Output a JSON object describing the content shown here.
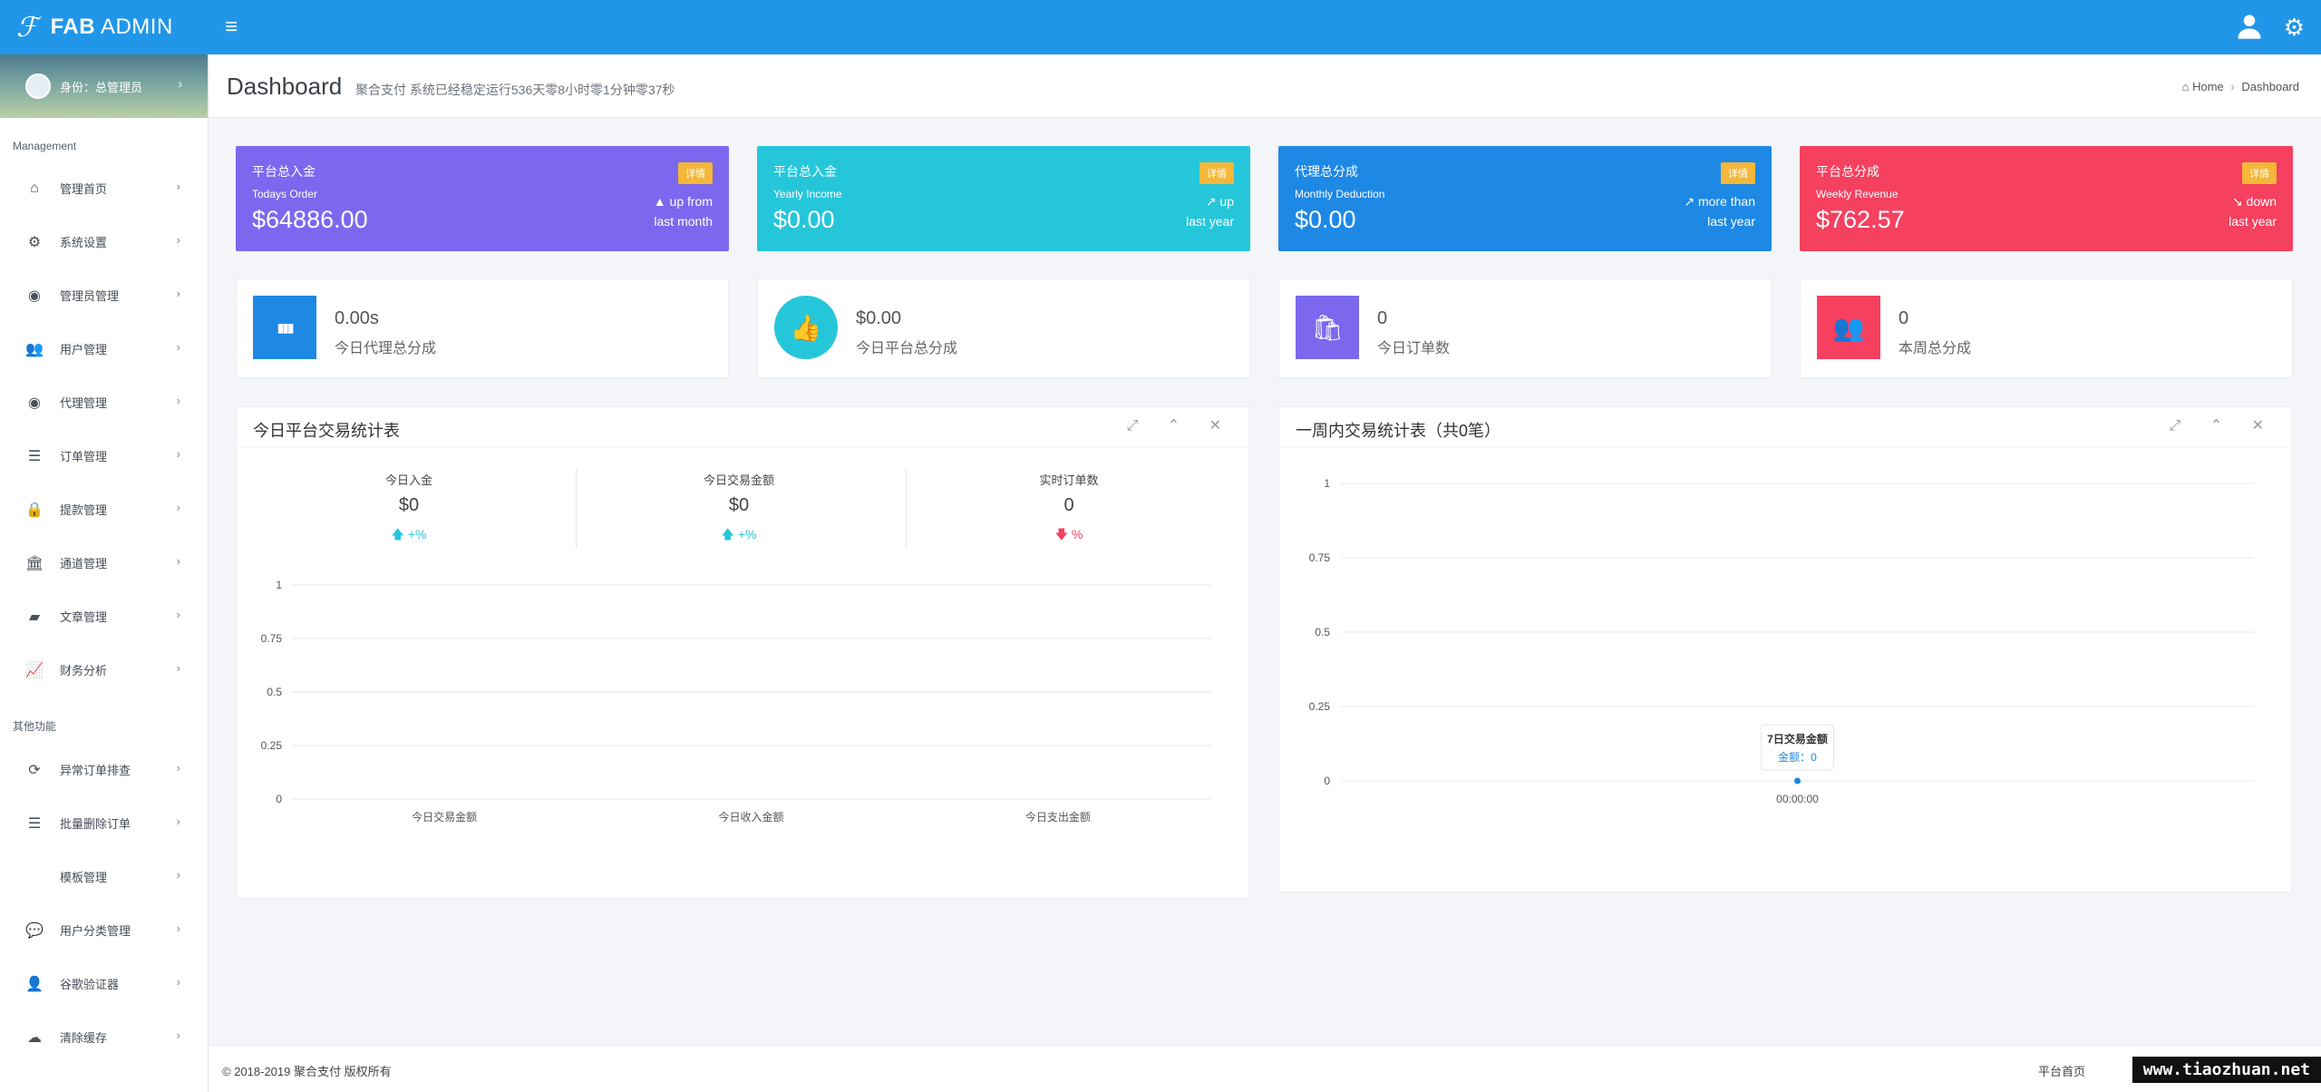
{
  "app": {
    "logo_mark": "ℱ",
    "logo_bold": "FAB",
    "logo_rest": " ADMIN",
    "menu_icon": "≡"
  },
  "profile": {
    "label": "身份：总管理员",
    "chevron": "›"
  },
  "sidebar": {
    "group1_title": "Management",
    "group1": [
      {
        "label": "管理首页",
        "icon": "home-icon",
        "glyph": "⌂"
      },
      {
        "label": "系统设置",
        "icon": "gears-icon",
        "glyph": "⚙"
      },
      {
        "label": "管理员管理",
        "icon": "user-circle-icon",
        "glyph": "◉"
      },
      {
        "label": "用户管理",
        "icon": "users-icon",
        "glyph": "👥"
      },
      {
        "label": "代理管理",
        "icon": "user-circle-icon",
        "glyph": "◉"
      },
      {
        "label": "订单管理",
        "icon": "list-icon",
        "glyph": "☰"
      },
      {
        "label": "提款管理",
        "icon": "lock-icon",
        "glyph": "🔒"
      },
      {
        "label": "通道管理",
        "icon": "bank-icon",
        "glyph": "🏛"
      },
      {
        "label": "文章管理",
        "icon": "book-icon",
        "glyph": "▰"
      },
      {
        "label": "财务分析",
        "icon": "line-chart-icon",
        "glyph": "📈"
      }
    ],
    "group2_title": "其他功能",
    "group2": [
      {
        "label": "异常订单排查",
        "icon": "refresh-icon",
        "glyph": "⟳"
      },
      {
        "label": "批量删除订单",
        "icon": "list-icon",
        "glyph": "☰"
      },
      {
        "label": "模板管理",
        "icon": "apple-icon",
        "glyph": ""
      },
      {
        "label": "用户分类管理",
        "icon": "wechat-icon",
        "glyph": "💬"
      },
      {
        "label": "谷歌验证器",
        "icon": "user-icon",
        "glyph": "👤"
      },
      {
        "label": "清除缓存",
        "icon": "cloud-icon",
        "glyph": "☁"
      }
    ],
    "chevron": "›"
  },
  "header": {
    "title": "Dashboard",
    "subtitle": "聚合支付 系统已经稳定运行536天零8小时零1分钟零37秒",
    "breadcrumb_home": "Home",
    "breadcrumb_sep": "›",
    "breadcrumb_current": "Dashboard"
  },
  "stat_cards": [
    {
      "title": "平台总入金",
      "sub": "Todays Order",
      "value": "$64886.00",
      "badge": "详情",
      "trend_l1": "up from",
      "trend_l2": "last month",
      "color": "#7b68ee",
      "arrow": "▲"
    },
    {
      "title": "平台总入金",
      "sub": "Yearly Income",
      "value": "$0.00",
      "badge": "详情",
      "trend_l1": "up",
      "trend_l2": "last year",
      "color": "#26c6da",
      "arrow": "↗"
    },
    {
      "title": "代理总分成",
      "sub": "Monthly Deduction",
      "value": "$0.00",
      "badge": "详情",
      "trend_l1": "more than",
      "trend_l2": "last year",
      "color": "#1e88e5",
      "arrow": "↗"
    },
    {
      "title": "平台总分成",
      "sub": "Weekly Revenue",
      "value": "$762.57",
      "badge": "详情",
      "trend_l1": "down",
      "trend_l2": "last year",
      "color": "#f5405f",
      "arrow": "↘"
    }
  ],
  "mini_cards": [
    {
      "value": "0.00s",
      "label": "今日代理总分成",
      "color": "#1e88e5",
      "icon": "bar-chart-icon",
      "glyph": "▮▮▮",
      "round": false
    },
    {
      "value": "$0.00",
      "label": "今日平台总分成",
      "color": "#26c6da",
      "icon": "thumbs-up-icon",
      "glyph": "👍",
      "round": true
    },
    {
      "value": "0",
      "label": "今日订单数",
      "color": "#7b68ee",
      "icon": "shopping-bag-icon",
      "glyph": "🛍",
      "round": false
    },
    {
      "value": "0",
      "label": "本周总分成",
      "color": "#f5405f",
      "icon": "users-icon",
      "glyph": "👥",
      "round": false
    }
  ],
  "panel_left": {
    "title": "今日平台交易统计表",
    "tools": "⤢ ⌃ ✕",
    "summary": [
      {
        "label": "今日入金",
        "value": "$0",
        "arrow": "🡅",
        "trend": "+%",
        "color": "#26c6da"
      },
      {
        "label": "今日交易金额",
        "value": "$0",
        "arrow": "🡅",
        "trend": "+%",
        "color": "#26c6da"
      },
      {
        "label": "实时订单数",
        "value": "0",
        "arrow": "🡇",
        "trend": "%",
        "color": "#f5405f"
      }
    ]
  },
  "panel_right": {
    "title": "一周内交易统计表（共0笔）",
    "tools": "⤢ ⌃ ✕",
    "tooltip_title": "7日交易金额",
    "tooltip_value": "金额：0"
  },
  "chart_data": [
    {
      "type": "bar",
      "categories": [
        "今日交易金额",
        "今日收入金额",
        "今日支出金额"
      ],
      "values": [
        0,
        0,
        0
      ],
      "ylim": [
        0,
        1
      ],
      "yticks": [
        "0",
        "0.25",
        "0.5",
        "0.75",
        "1"
      ],
      "grid": true
    },
    {
      "type": "line",
      "x": [
        "00:00:00"
      ],
      "series": [
        {
          "values": [
            0
          ]
        }
      ],
      "ylim": [
        0,
        1
      ],
      "yticks": [
        "0",
        "0.25",
        "0.5",
        "0.75",
        "1"
      ],
      "grid": true,
      "color": "#1e88e5"
    }
  ],
  "footer": {
    "copyright": "© 2018-2019 聚合支付 版权所有",
    "link": "平台首页",
    "watermark": "www.tiaozhuan.net"
  }
}
